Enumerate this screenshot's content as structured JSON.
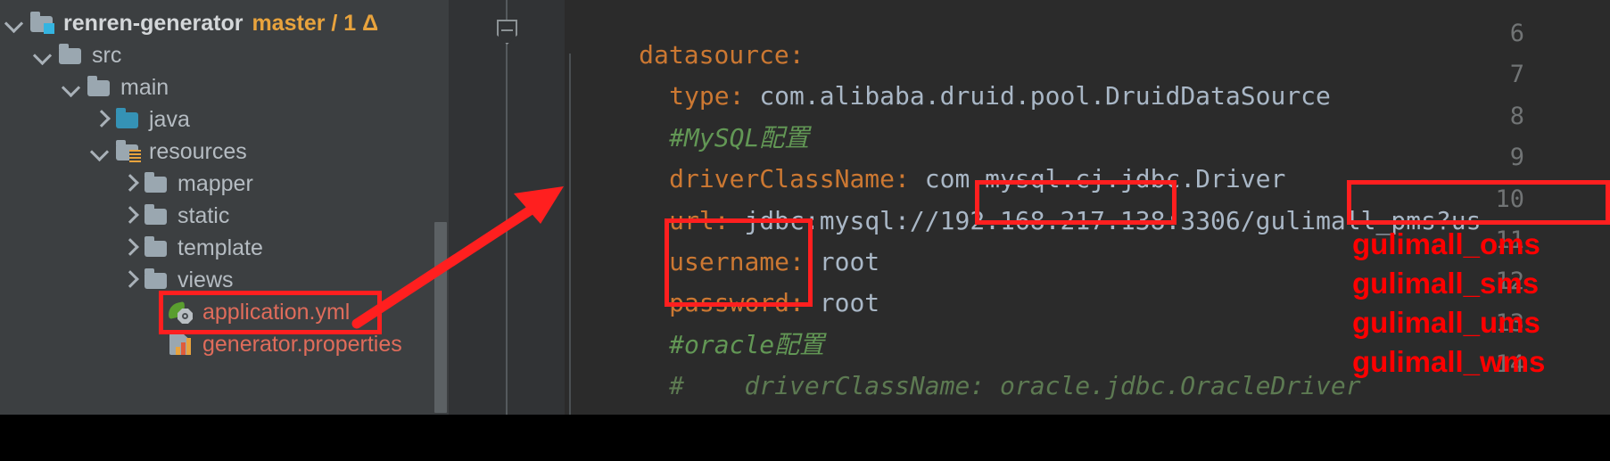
{
  "window": {
    "theme_bg": "#3c3f41",
    "editor_bg": "#2b2b2b",
    "accent_red": "#ff0000"
  },
  "project_tree": {
    "items": [
      {
        "label": "renren-generator",
        "branch": "master / 1 Δ",
        "icon": "module-folder-icon",
        "arrow": "expanded",
        "depth": 0
      },
      {
        "label": "src",
        "icon": "folder-icon",
        "arrow": "expanded",
        "depth": 1
      },
      {
        "label": "main",
        "icon": "folder-icon",
        "arrow": "expanded",
        "depth": 2
      },
      {
        "label": "java",
        "icon": "source-folder-icon",
        "arrow": "collapsed",
        "depth": 3
      },
      {
        "label": "resources",
        "icon": "resources-folder-icon",
        "arrow": "expanded",
        "depth": 3
      },
      {
        "label": "mapper",
        "icon": "folder-icon",
        "arrow": "collapsed",
        "depth": 4
      },
      {
        "label": "static",
        "icon": "folder-icon",
        "arrow": "collapsed",
        "depth": 4
      },
      {
        "label": "template",
        "icon": "folder-icon",
        "arrow": "collapsed",
        "depth": 4
      },
      {
        "label": "views",
        "icon": "folder-icon",
        "arrow": "collapsed",
        "depth": 4
      },
      {
        "label": "application.yml",
        "icon": "spring-yaml-icon",
        "arrow": "none",
        "depth": 4,
        "highlighted": true
      },
      {
        "label": "generator.properties",
        "icon": "properties-icon",
        "arrow": "none",
        "depth": 4
      }
    ]
  },
  "editor": {
    "line_numbers": [
      "6",
      "7",
      "8",
      "9",
      "10",
      "11",
      "12",
      "13",
      "14"
    ],
    "lines": [
      {
        "num": "6",
        "segments": [
          {
            "t": "datasource:",
            "c": "k"
          }
        ]
      },
      {
        "num": "7",
        "segments": [
          {
            "t": "  type",
            "c": "k"
          },
          {
            "t": ": ",
            "c": "v"
          },
          {
            "t": "com.alibaba.druid.pool.DruidDataSource",
            "c": "v"
          }
        ]
      },
      {
        "num": "8",
        "segments": [
          {
            "t": "  #MySQL配置",
            "c": "cmt"
          }
        ]
      },
      {
        "num": "9",
        "segments": [
          {
            "t": "  driverClassName",
            "c": "k"
          },
          {
            "t": ": ",
            "c": "v"
          },
          {
            "t": "com.mysql.cj.jdbc.Driver",
            "c": "v"
          }
        ]
      },
      {
        "num": "10",
        "segments": [
          {
            "t": "  url",
            "c": "k"
          },
          {
            "t": ": ",
            "c": "v"
          },
          {
            "t": "jdbc:mysql://192.168.217.138:3306/gulimall_pms?us",
            "c": "v"
          }
        ]
      },
      {
        "num": "11",
        "segments": [
          {
            "t": "  username",
            "c": "k"
          },
          {
            "t": ": ",
            "c": "v"
          },
          {
            "t": "root",
            "c": "v"
          }
        ]
      },
      {
        "num": "12",
        "segments": [
          {
            "t": "  password",
            "c": "k"
          },
          {
            "t": ": ",
            "c": "v"
          },
          {
            "t": "root",
            "c": "v"
          }
        ]
      },
      {
        "num": "13",
        "segments": [
          {
            "t": "  #oracle配置",
            "c": "cmt"
          }
        ]
      },
      {
        "num": "14",
        "segments": [
          {
            "t": "  #    driverClassName: oracle.jdbc.OracleDriver",
            "c": "cmt-dim"
          }
        ]
      }
    ],
    "line6_text": "datasource:",
    "line7_key": "type:",
    "line7_val": "com.alibaba.druid.pool.DruidDataSource",
    "line8_text": "#MySQL配置",
    "line9_key": "driverClassName:",
    "line9_val": "com.mysql.cj.jdbc.Driver",
    "line10_key": "url:",
    "line10_prefix": "jdbc:mysql://",
    "line10_host": "192.168.217.138",
    "line10_port": ":3306/",
    "line10_db": "gulimall_pms?us",
    "line11_key": "username:",
    "line11_val": "root",
    "line12_key": "password:",
    "line12_val": "root",
    "line13_text": "#oracle配置",
    "line14_text": "#    driverClassName: oracle.jdbc.OracleDriver"
  },
  "annotations": {
    "database_names": [
      "gulimall_oms",
      "gulimall_sms",
      "gulimall_ums",
      "gulimall_wms"
    ]
  }
}
